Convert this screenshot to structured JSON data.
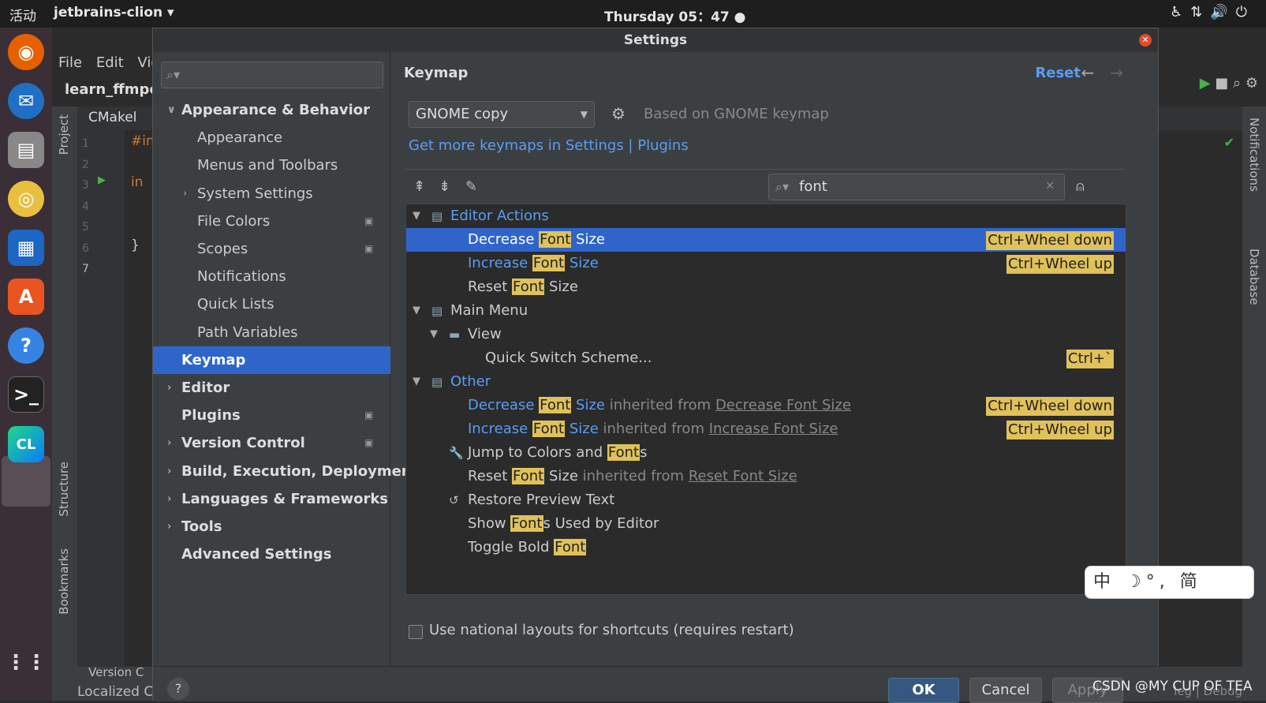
{
  "topbar": {
    "activities": "活动",
    "app": "jetbrains-clion ▾",
    "clock": "Thursday 05：47 ●"
  },
  "ide": {
    "menu": "File Edit Vie",
    "project": "learn_ffmpe",
    "tab": "CMakel",
    "left_panel_project": "Project",
    "left_panel_structure": "Structure",
    "left_panel_bookmarks": "Bookmarks",
    "right_panel_notifications": "Notifications",
    "right_panel_database": "Database",
    "gutter_lines": [
      "1",
      "2",
      "3",
      "4",
      "5",
      "6",
      "7"
    ],
    "code_include": "#in",
    "code_int": "in",
    "code_brace": "}",
    "bottom_version": "Version C",
    "bottom_localized": "Localized C",
    "bottom_right": "leg | Debug"
  },
  "dialog": {
    "title": "Settings",
    "search_placeholder": "",
    "sidebar": [
      {
        "label": "Appearance & Behavior",
        "level": 0,
        "bold": true,
        "chevron": "expanded"
      },
      {
        "label": "Appearance",
        "level": 1
      },
      {
        "label": "Menus and Toolbars",
        "level": 1
      },
      {
        "label": "System Settings",
        "level": 1,
        "chevron": "collapsed"
      },
      {
        "label": "File Colors",
        "level": 1,
        "modified": true
      },
      {
        "label": "Scopes",
        "level": 1,
        "modified": true
      },
      {
        "label": "Notifications",
        "level": 1
      },
      {
        "label": "Quick Lists",
        "level": 1
      },
      {
        "label": "Path Variables",
        "level": 1
      },
      {
        "label": "Keymap",
        "level": 0,
        "bold": true,
        "selected": true
      },
      {
        "label": "Editor",
        "level": 0,
        "bold": true,
        "chevron": "collapsed"
      },
      {
        "label": "Plugins",
        "level": 0,
        "bold": true,
        "modified": true
      },
      {
        "label": "Version Control",
        "level": 0,
        "bold": true,
        "chevron": "collapsed",
        "modified": true
      },
      {
        "label": "Build, Execution, Deploymen",
        "level": 0,
        "bold": true,
        "chevron": "collapsed"
      },
      {
        "label": "Languages & Frameworks",
        "level": 0,
        "bold": true,
        "chevron": "collapsed"
      },
      {
        "label": "Tools",
        "level": 0,
        "bold": true,
        "chevron": "collapsed"
      },
      {
        "label": "Advanced Settings",
        "level": 0,
        "bold": true
      }
    ],
    "breadcrumb": "Keymap",
    "reset_label": "Reset",
    "keymap_combo": "GNOME copy",
    "based_on": "Based on GNOME keymap",
    "more_keymaps": "Get more keymaps in Settings | Plugins",
    "filter_value": "font",
    "national_layouts": "Use national layouts for shortcuts (requires restart)",
    "ok_label": "OK",
    "cancel_label": "Cancel",
    "apply_label": "Apply",
    "help_label": "?"
  },
  "ime": "中 ☽°, 简",
  "watermark": "CSDN @MY CUP OF TEA",
  "colors": {
    "accent": "#2f65ca",
    "highlight": "#e0c15a",
    "link": "#589df6",
    "ok_button": "#365880"
  }
}
